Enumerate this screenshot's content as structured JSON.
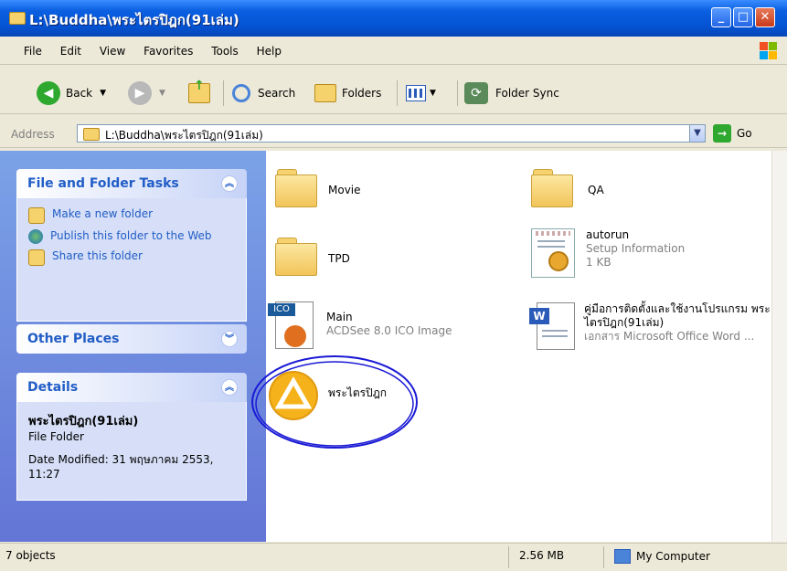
{
  "window": {
    "title": "L:\\Buddha\\พระไตรปิฎก(91เล่ม)",
    "controls": {
      "minimize": "_",
      "maximize": "□",
      "close": "✕"
    }
  },
  "menu": {
    "items": [
      "File",
      "Edit",
      "View",
      "Favorites",
      "Tools",
      "Help"
    ]
  },
  "toolbar": {
    "back_label": "Back",
    "search_label": "Search",
    "folders_label": "Folders",
    "folder_sync_label": "Folder Sync"
  },
  "address": {
    "label": "Address",
    "value": "L:\\Buddha\\พระไตรปิฎก(91เล่ม)",
    "go_label": "Go"
  },
  "sidepane": {
    "file_tasks": {
      "title": "File and Folder Tasks",
      "tasks": [
        "Make a new folder",
        "Publish this folder to the Web",
        "Share this folder"
      ]
    },
    "other_places": {
      "title": "Other Places"
    },
    "details": {
      "title": "Details",
      "name": "พระไตรปิฎก(91เล่ม)",
      "type": "File Folder",
      "date": "Date Modified: 31 พฤษภาคม 2553, 11:27"
    }
  },
  "files": [
    {
      "name": "Movie",
      "kind": "folder"
    },
    {
      "name": "QA",
      "kind": "folder"
    },
    {
      "name": "TPD",
      "kind": "folder"
    },
    {
      "name": "autorun",
      "kind": "inf",
      "sub1": "Setup Information",
      "sub2": "1 KB"
    },
    {
      "name": "Main",
      "kind": "ico",
      "sub1": "ACDSee 8.0 ICO Image",
      "badge": "ICO"
    },
    {
      "name": "คู่มือการติดตั้งและใช้งานโปรแกรม พระไตรปิฎก(91เล่ม)",
      "kind": "doc",
      "sub1": "เอกสาร Microsoft Office Word ..."
    },
    {
      "name": "พระไตรปิฎก",
      "kind": "app"
    }
  ],
  "status": {
    "count": "7 objects",
    "size": "2.56 MB",
    "location": "My Computer"
  },
  "colors": {
    "titlebar": "#0554d4",
    "sidepane": "#6375d6",
    "link": "#215dc6",
    "annotation_circle": "#1a1ad6"
  }
}
